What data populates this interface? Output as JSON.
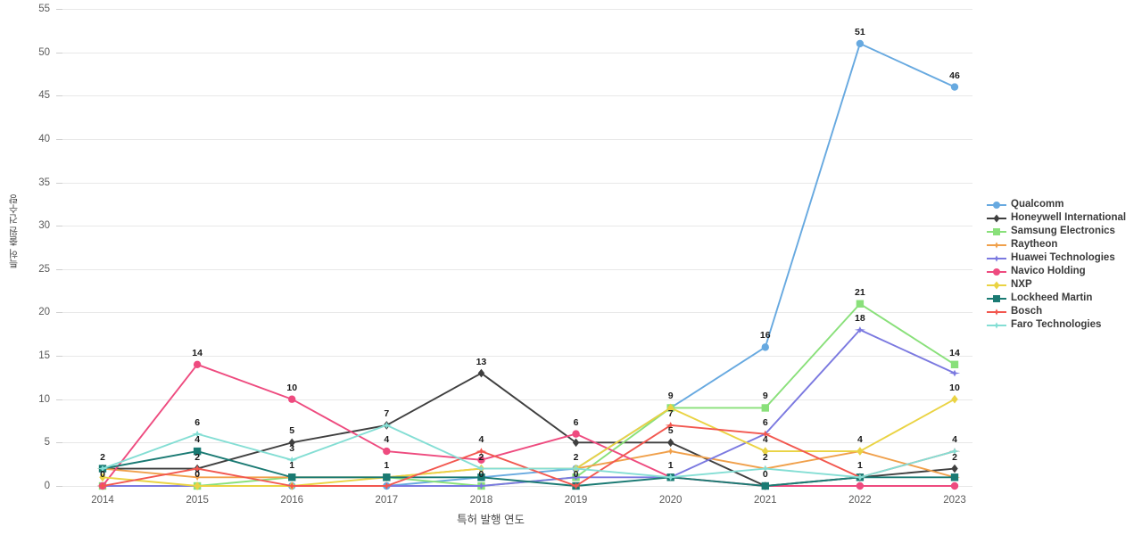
{
  "chart_data": {
    "type": "line",
    "title": "",
    "xlabel": "특허 발행 연도",
    "ylabel": "특허 출원 건수량",
    "categories": [
      "2014",
      "2015",
      "2016",
      "2017",
      "2018",
      "2019",
      "2020",
      "2021",
      "2022",
      "2023"
    ],
    "ylim": [
      0,
      55
    ],
    "yticks": [
      0,
      5,
      10,
      15,
      20,
      25,
      30,
      35,
      40,
      45,
      50,
      55
    ],
    "grid": true,
    "legend_position": "right",
    "series": [
      {
        "name": "Qualcomm",
        "color": "#67a9e0",
        "marker": "circle",
        "values": [
          0,
          0,
          0,
          0,
          1,
          2,
          9,
          16,
          51,
          46
        ]
      },
      {
        "name": "Honeywell International",
        "color": "#3f3f3f",
        "marker": "diamond",
        "values": [
          2,
          2,
          5,
          7,
          13,
          5,
          5,
          0,
          1,
          2
        ]
      },
      {
        "name": "Samsung Electronics",
        "color": "#89e07a",
        "marker": "square",
        "values": [
          0,
          0,
          1,
          1,
          0,
          1,
          9,
          9,
          21,
          14
        ]
      },
      {
        "name": "Raytheon",
        "color": "#f0a04b",
        "marker": "star",
        "values": [
          2,
          1,
          1,
          1,
          2,
          2,
          4,
          2,
          4,
          1
        ]
      },
      {
        "name": "Huawei Technologies",
        "color": "#7b79e0",
        "marker": "star",
        "values": [
          0,
          0,
          0,
          0,
          0,
          1,
          1,
          6,
          18,
          13
        ]
      },
      {
        "name": "Navico Holding",
        "color": "#ee4b7f",
        "marker": "circle",
        "values": [
          0,
          14,
          10,
          4,
          3,
          6,
          1,
          0,
          0,
          0
        ]
      },
      {
        "name": "NXP",
        "color": "#ead343",
        "marker": "diamond",
        "values": [
          1,
          0,
          0,
          1,
          2,
          2,
          9,
          4,
          4,
          10
        ]
      },
      {
        "name": "Lockheed Martin",
        "color": "#1a7a73",
        "marker": "square",
        "values": [
          2,
          4,
          1,
          1,
          1,
          0,
          1,
          0,
          1,
          1
        ]
      },
      {
        "name": "Bosch",
        "color": "#f2574f",
        "marker": "star",
        "values": [
          0,
          2,
          0,
          0,
          4,
          0,
          7,
          6,
          1,
          4
        ]
      },
      {
        "name": "Faro Technologies",
        "color": "#84ded4",
        "marker": "star",
        "values": [
          2,
          6,
          3,
          7,
          2,
          2,
          1,
          2,
          1,
          4
        ]
      }
    ],
    "point_labels": [
      {
        "series": "Lockheed Martin",
        "x": "2014",
        "value": 2,
        "text": "2"
      },
      {
        "series": "Navico Holding",
        "x": "2014",
        "value": 0,
        "text": "0"
      },
      {
        "series": "Navico Holding",
        "x": "2015",
        "value": 14,
        "text": "14"
      },
      {
        "series": "Faro Technologies",
        "x": "2015",
        "value": 6,
        "text": "6"
      },
      {
        "series": "Lockheed Martin",
        "x": "2015",
        "value": 4,
        "text": "4"
      },
      {
        "series": "Bosch",
        "x": "2015",
        "value": 2,
        "text": "2"
      },
      {
        "series": "Samsung Electronics",
        "x": "2015",
        "value": 0,
        "text": "0"
      },
      {
        "series": "Navico Holding",
        "x": "2016",
        "value": 10,
        "text": "10"
      },
      {
        "series": "Honeywell International",
        "x": "2016",
        "value": 5,
        "text": "5"
      },
      {
        "series": "Faro Technologies",
        "x": "2016",
        "value": 3,
        "text": "3"
      },
      {
        "series": "Lockheed Martin",
        "x": "2016",
        "value": 1,
        "text": "1"
      },
      {
        "series": "Faro Technologies",
        "x": "2017",
        "value": 7,
        "text": "7"
      },
      {
        "series": "Navico Holding",
        "x": "2017",
        "value": 4,
        "text": "4"
      },
      {
        "series": "Lockheed Martin",
        "x": "2017",
        "value": 1,
        "text": "1"
      },
      {
        "series": "Honeywell International",
        "x": "2018",
        "value": 13,
        "text": "13"
      },
      {
        "series": "Bosch",
        "x": "2018",
        "value": 4,
        "text": "4"
      },
      {
        "series": "Faro Technologies",
        "x": "2018",
        "value": 2,
        "text": "2"
      },
      {
        "series": "Samsung Electronics",
        "x": "2018",
        "value": 0,
        "text": "0"
      },
      {
        "series": "Navico Holding",
        "x": "2019",
        "value": 6,
        "text": "6"
      },
      {
        "series": "Faro Technologies",
        "x": "2019",
        "value": 2,
        "text": "2"
      },
      {
        "series": "Bosch",
        "x": "2019",
        "value": 0,
        "text": "0"
      },
      {
        "series": "Samsung Electronics",
        "x": "2020",
        "value": 9,
        "text": "9"
      },
      {
        "series": "Bosch",
        "x": "2020",
        "value": 7,
        "text": "7"
      },
      {
        "series": "Honeywell International",
        "x": "2020",
        "value": 5,
        "text": "5"
      },
      {
        "series": "Faro Technologies",
        "x": "2020",
        "value": 1,
        "text": "1"
      },
      {
        "series": "Qualcomm",
        "x": "2021",
        "value": 16,
        "text": "16"
      },
      {
        "series": "Samsung Electronics",
        "x": "2021",
        "value": 9,
        "text": "9"
      },
      {
        "series": "Bosch",
        "x": "2021",
        "value": 6,
        "text": "6"
      },
      {
        "series": "NXP",
        "x": "2021",
        "value": 4,
        "text": "4"
      },
      {
        "series": "Faro Technologies",
        "x": "2021",
        "value": 2,
        "text": "2"
      },
      {
        "series": "Honeywell International",
        "x": "2021",
        "value": 0,
        "text": "0"
      },
      {
        "series": "Qualcomm",
        "x": "2022",
        "value": 51,
        "text": "51"
      },
      {
        "series": "Samsung Electronics",
        "x": "2022",
        "value": 21,
        "text": "21"
      },
      {
        "series": "Huawei Technologies",
        "x": "2022",
        "value": 18,
        "text": "18"
      },
      {
        "series": "Raytheon",
        "x": "2022",
        "value": 4,
        "text": "4"
      },
      {
        "series": "Faro Technologies",
        "x": "2022",
        "value": 1,
        "text": "1"
      },
      {
        "series": "Qualcomm",
        "x": "2023",
        "value": 46,
        "text": "46"
      },
      {
        "series": "Samsung Electronics",
        "x": "2023",
        "value": 14,
        "text": "14"
      },
      {
        "series": "NXP",
        "x": "2023",
        "value": 10,
        "text": "10"
      },
      {
        "series": "Bosch",
        "x": "2023",
        "value": 4,
        "text": "4"
      },
      {
        "series": "Honeywell International",
        "x": "2023",
        "value": 2,
        "text": "2"
      }
    ]
  },
  "legend": {
    "items": [
      {
        "label": "Qualcomm"
      },
      {
        "label": "Honeywell International"
      },
      {
        "label": "Samsung Electronics"
      },
      {
        "label": "Raytheon"
      },
      {
        "label": "Huawei Technologies"
      },
      {
        "label": "Navico Holding"
      },
      {
        "label": "NXP"
      },
      {
        "label": "Lockheed Martin"
      },
      {
        "label": "Bosch"
      },
      {
        "label": "Faro Technologies"
      }
    ]
  }
}
